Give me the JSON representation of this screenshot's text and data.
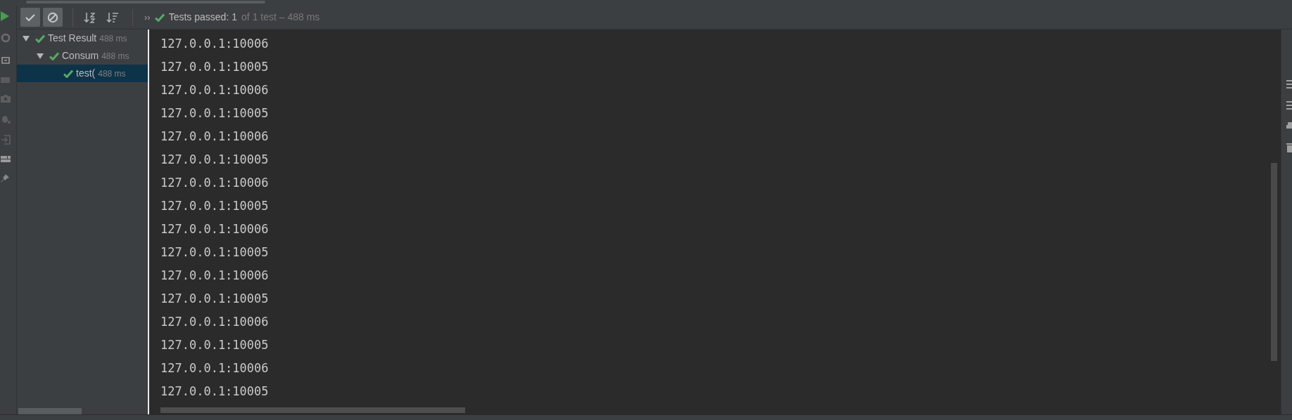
{
  "toolbar": {
    "buttons": [
      {
        "kind": "passed-filter",
        "on": true
      },
      {
        "kind": "ignored-filter",
        "on": true
      },
      {
        "kind": "sort-alpha",
        "on": false
      },
      {
        "kind": "sort-duration",
        "on": false
      }
    ],
    "expand": "››",
    "status": {
      "label": "Tests passed:",
      "count": "1",
      "detail": "of 1 test – 488 ms"
    }
  },
  "tree": [
    {
      "name": "Test Result",
      "time": "488 ms",
      "expanded": true,
      "selected": false,
      "children": [
        {
          "name": "Consum",
          "time": "488 ms",
          "expanded": true,
          "selected": false,
          "children": [
            {
              "name": "test(",
              "time": "488 ms",
              "selected": true
            }
          ]
        }
      ]
    }
  ],
  "console": {
    "lines": [
      "127.0.0.1:10006",
      "127.0.0.1:10005",
      "127.0.0.1:10006",
      "127.0.0.1:10005",
      "127.0.0.1:10006",
      "127.0.0.1:10005",
      "127.0.0.1:10006",
      "127.0.0.1:10005",
      "127.0.0.1:10006",
      "127.0.0.1:10005",
      "127.0.0.1:10006",
      "127.0.0.1:10005",
      "127.0.0.1:10006",
      "127.0.0.1:10005",
      "127.0.0.1:10006",
      "127.0.0.1:10005"
    ]
  }
}
